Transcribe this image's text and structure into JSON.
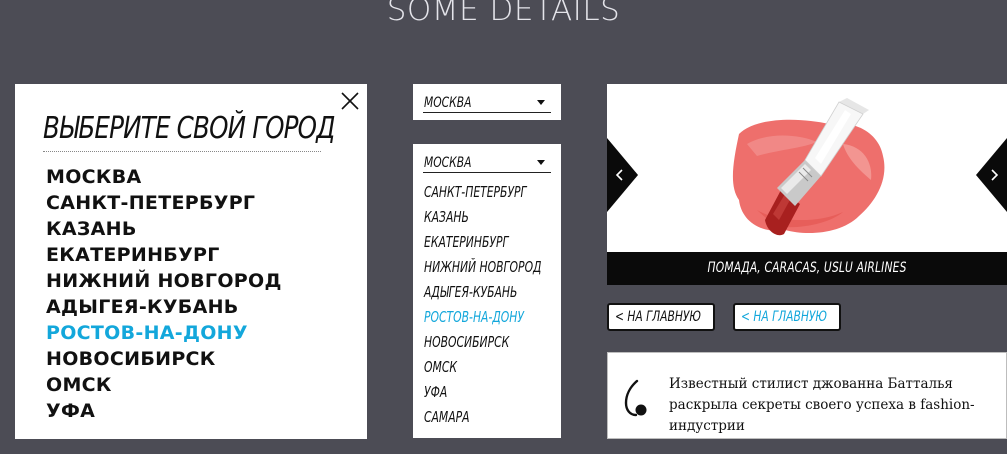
{
  "page": {
    "heading": "SOME DETAILS"
  },
  "modal": {
    "title": "ВЫБЕРИТЕ СВОЙ ГОРОД",
    "close_icon": "close-icon",
    "cities": [
      "МОСКВА",
      "САНКТ-ПЕТЕРБУРГ",
      "КАЗАНЬ",
      "ЕКАТЕРИНБУРГ",
      "НИЖНИЙ НОВГОРОД",
      "АДЫГЕЯ-КУБАНЬ",
      "РОСТОВ-НА-ДОНУ",
      "НОВОСИБИРСК",
      "ОМСК",
      "УФА"
    ],
    "active_city": "РОСТОВ-НА-ДОНУ"
  },
  "dropdown_collapsed": {
    "selected": "МОСКВА",
    "arrow_icon": "caret-down-icon"
  },
  "dropdown_open": {
    "selected": "МОСКВА",
    "arrow_icon": "caret-down-icon",
    "options": [
      "САНКТ-ПЕТЕРБУРГ",
      "КАЗАНЬ",
      "ЕКАТЕРИНБУРГ",
      "НИЖНИЙ НОВГОРОД",
      "АДЫГЕЯ-КУБАНЬ",
      "РОСТОВ-НА-ДОНУ",
      "НОВОСИБИРСК",
      "ОМСК",
      "УФА",
      "САМАРА"
    ],
    "active_option": "РОСТОВ-НА-ДОНУ"
  },
  "slider": {
    "caption": "ПОМАДА, CARACAS, USLU AIRLINES",
    "prev_icon": "chevron-left-icon",
    "next_icon": "chevron-right-icon",
    "image_icon": "lipstick-icon"
  },
  "buttons": [
    {
      "label": "НА ГЛАВНУЮ",
      "icon": "chevron-left-icon",
      "state": "default"
    },
    {
      "label": "НА ГЛАВНУЮ",
      "icon": "chevron-left-icon",
      "state": "hover"
    }
  ],
  "quote": {
    "icon": "quote-mark-icon",
    "text": "Известный стилист джованна Батталья раскрыла секреты своего успеха в fashion-индустрии"
  },
  "colors": {
    "background": "#4c4c55",
    "accent": "#13a7db",
    "text": "#111111",
    "caption_bar": "#0a0a0a",
    "lipstick_smear": "#ee6f6c",
    "lipstick_bullet": "#a8201f"
  }
}
